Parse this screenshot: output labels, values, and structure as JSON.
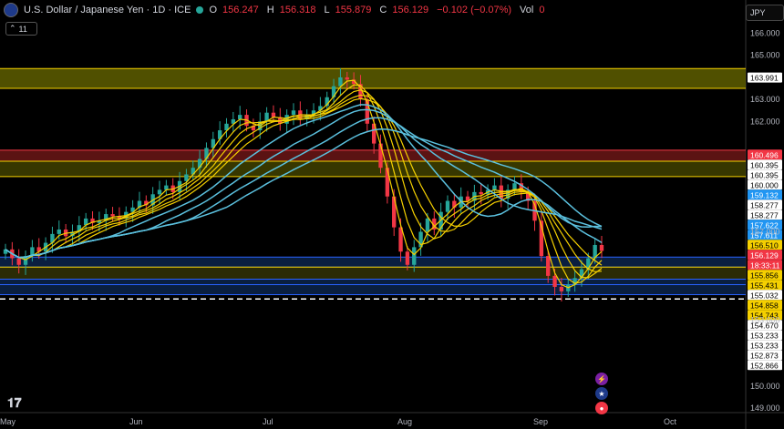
{
  "header": {
    "symbol": "U.S. Dollar / Japanese Yen · 1D · ICE",
    "o_label": "O",
    "o": "156.247",
    "h_label": "H",
    "h": "156.318",
    "l_label": "L",
    "l": "155.879",
    "c_label": "C",
    "c": "156.129",
    "change": "−0.102 (−0.07%)",
    "vol_label": "Vol",
    "vol": "0",
    "indicator_count": "11"
  },
  "currency_button": "JPY",
  "colors": {
    "up": "#26a69a",
    "down": "#f23645",
    "ma_yellow": "#f5d000",
    "ma_cyan": "#5bc0de"
  },
  "icons": [
    "tradingview-logo-icon",
    "flash-event-icon",
    "us-flag-event-icon",
    "red-event-icon"
  ],
  "chart_data": {
    "type": "candlestick",
    "x_labels": [
      "May",
      "Jun",
      "Jul",
      "Aug",
      "Sep",
      "Oct"
    ],
    "y_ticks": [
      "166.000",
      "165.000",
      "163.000",
      "162.000",
      "157.000",
      "153.000",
      "150.000",
      "149.000"
    ],
    "ylim": [
      148.8,
      166.6
    ],
    "price_tags": [
      {
        "label": "163.991",
        "value": 163.991,
        "bg": "#ffffff",
        "fg": "#000000"
      },
      {
        "label": "160.496",
        "value": 160.496,
        "bg": "#f23645",
        "fg": "#ffffff"
      },
      {
        "label": "160.395",
        "value": 160.395,
        "bg": "#ffffff",
        "fg": "#000000"
      },
      {
        "label": "160.395",
        "value": 160.395,
        "bg": "#ffffff",
        "fg": "#000000"
      },
      {
        "label": "160.000",
        "value": 160.0,
        "bg": "#ffffff",
        "fg": "#000000"
      },
      {
        "label": "159.132",
        "value": 159.132,
        "bg": "#2196f3",
        "fg": "#ffffff"
      },
      {
        "label": "158.277",
        "value": 158.277,
        "bg": "#ffffff",
        "fg": "#000000"
      },
      {
        "label": "158.277",
        "value": 158.277,
        "bg": "#ffffff",
        "fg": "#000000"
      },
      {
        "label": "157.622",
        "value": 157.622,
        "bg": "#2196f3",
        "fg": "#ffffff"
      },
      {
        "label": "157.611",
        "value": 157.611,
        "bg": "#2196f3",
        "fg": "#ffffff"
      },
      {
        "label": "156.510",
        "value": 156.51,
        "bg": "#f5d000",
        "fg": "#000000"
      },
      {
        "label": "156.129",
        "value": 156.129,
        "bg": "#f23645",
        "fg": "#ffffff"
      },
      {
        "label": "18:33:11",
        "value": 155.93,
        "bg": "#f23645",
        "fg": "#ffffff"
      },
      {
        "label": "155.856",
        "value": 155.856,
        "bg": "#f5d000",
        "fg": "#000000"
      },
      {
        "label": "155.431",
        "value": 155.431,
        "bg": "#f5d000",
        "fg": "#000000"
      },
      {
        "label": "155.032",
        "value": 155.032,
        "bg": "#ffffff",
        "fg": "#000000"
      },
      {
        "label": "154.858",
        "value": 154.858,
        "bg": "#f5d000",
        "fg": "#000000"
      },
      {
        "label": "154.743",
        "value": 154.743,
        "bg": "#f5d000",
        "fg": "#000000"
      },
      {
        "label": "154.670",
        "value": 154.67,
        "bg": "#ffffff",
        "fg": "#000000"
      },
      {
        "label": "153.233",
        "value": 153.233,
        "bg": "#ffffff",
        "fg": "#000000"
      },
      {
        "label": "153.233",
        "value": 153.233,
        "bg": "#ffffff",
        "fg": "#000000"
      },
      {
        "label": "152.873",
        "value": 152.873,
        "bg": "#ffffff",
        "fg": "#000000"
      },
      {
        "label": "152.866",
        "value": 152.866,
        "bg": "#ffffff",
        "fg": "#000000"
      }
    ],
    "zones": [
      {
        "from": 163.5,
        "to": 164.4,
        "fill": "#6b6b00",
        "line": "#f5d000"
      },
      {
        "from": 160.2,
        "to": 160.7,
        "fill": "#7a1a1a",
        "line": "#f23645"
      },
      {
        "from": 159.5,
        "to": 160.2,
        "fill": "#4a4a00",
        "line": "#f5d000"
      },
      {
        "from": 155.4,
        "to": 155.85,
        "fill": "#0d2a55",
        "line": "#2962ff"
      },
      {
        "from": 154.85,
        "to": 155.4,
        "fill": "#3a3a05",
        "line": "#f5d000"
      },
      {
        "from": 154.6,
        "to": 154.85,
        "fill": "#0d2a55",
        "line": "#2962ff"
      },
      {
        "from": 154.15,
        "to": 154.6,
        "fill": "#0d2a55",
        "line": "#2962ff"
      }
    ],
    "dashed_lines": [
      {
        "value": 153.95,
        "color": "#ffffff"
      }
    ],
    "closes": [
      156.2,
      155.8,
      155.5,
      155.9,
      156.3,
      156.1,
      156.5,
      156.9,
      157.1,
      156.8,
      157.0,
      157.3,
      157.6,
      157.4,
      157.5,
      157.8,
      157.7,
      157.6,
      157.9,
      158.1,
      158.4,
      158.2,
      158.7,
      158.9,
      159.1,
      158.8,
      159.3,
      159.6,
      159.9,
      160.3,
      160.8,
      161.2,
      161.6,
      161.9,
      162.1,
      162.3,
      161.8,
      161.6,
      162.0,
      162.4,
      162.2,
      161.9,
      162.3,
      162.5,
      162.1,
      162.3,
      162.5,
      162.7,
      163.1,
      163.6,
      164.0,
      163.9,
      163.7,
      163.0,
      161.9,
      161.0,
      159.9,
      158.6,
      157.2,
      156.1,
      155.5,
      156.3,
      157.0,
      157.6,
      157.1,
      157.9,
      158.4,
      158.1,
      158.6,
      158.4,
      158.8,
      158.7,
      158.9,
      159.1,
      158.5,
      158.9,
      159.2,
      158.8,
      158.4,
      157.5,
      155.9,
      155.0,
      154.5,
      154.3,
      154.6,
      154.9,
      155.3,
      155.8,
      156.4,
      156.129
    ]
  }
}
